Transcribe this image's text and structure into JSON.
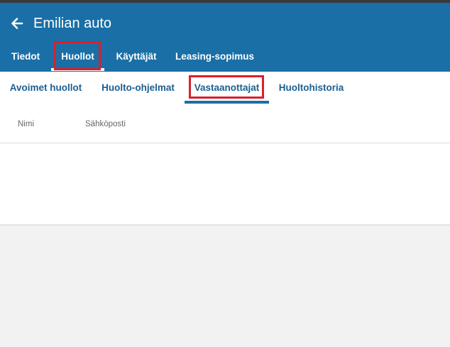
{
  "header": {
    "title": "Emilian auto",
    "back_icon": "arrow-left-icon",
    "background": "#1a6fa6"
  },
  "main_tabs": [
    {
      "label": "Tiedot",
      "active": false
    },
    {
      "label": "Huollot",
      "active": true,
      "highlighted": true
    },
    {
      "label": "Käyttäjät",
      "active": false
    },
    {
      "label": "Leasing-sopimus",
      "active": false
    }
  ],
  "sub_tabs": [
    {
      "label": "Avoimet huollot",
      "active": false
    },
    {
      "label": "Huolto-ohjelmat",
      "active": false
    },
    {
      "label": "Vastaanottajat",
      "active": true,
      "highlighted": true
    },
    {
      "label": "Huoltohistoria",
      "active": false
    }
  ],
  "table": {
    "columns": [
      "Nimi",
      "Sähköposti"
    ],
    "rows": []
  },
  "colors": {
    "accent": "#1a6fa6",
    "tab_text": "#1b5f91",
    "highlight": "#d9202b"
  }
}
